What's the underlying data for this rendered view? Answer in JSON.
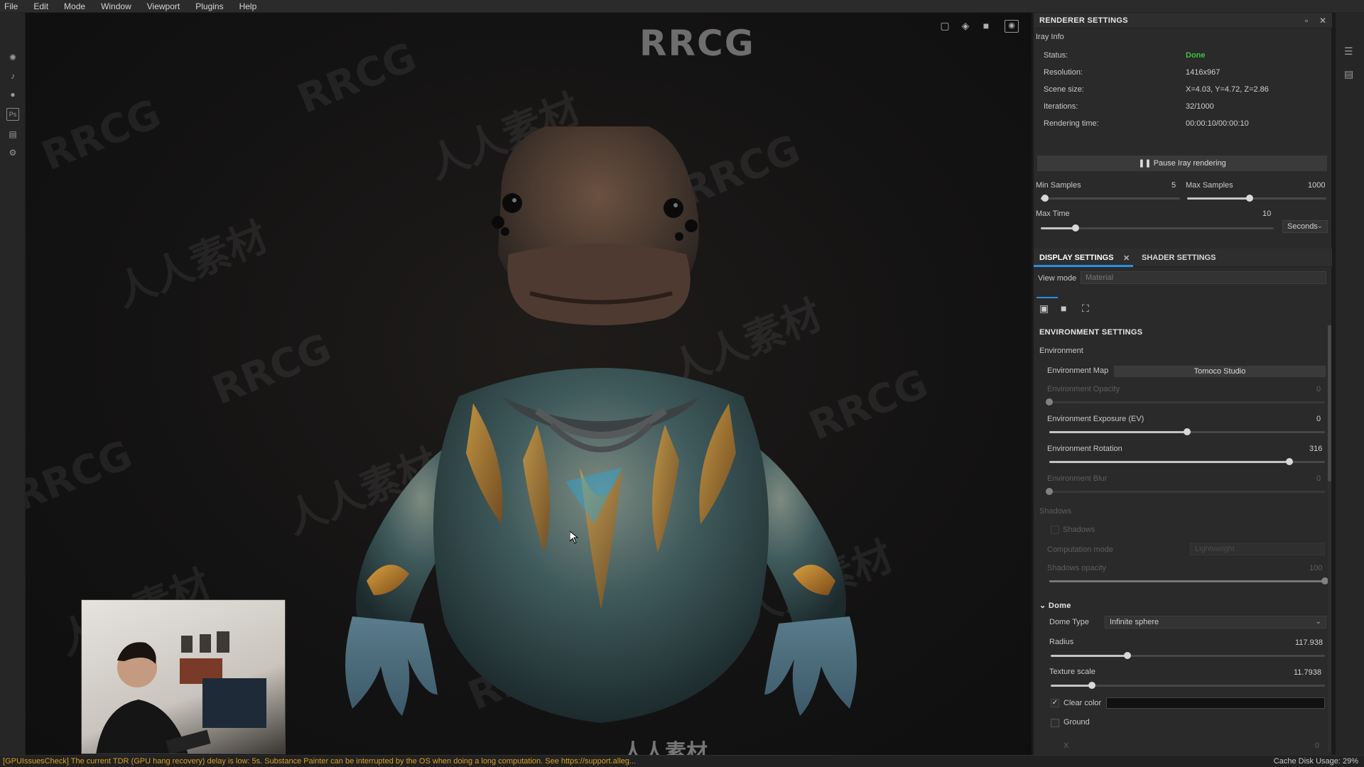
{
  "menu": [
    "File",
    "Edit",
    "Mode",
    "Window",
    "Viewport",
    "Plugins",
    "Help"
  ],
  "viewport": {
    "brand": "RRCG",
    "footer_logo": "人人素材",
    "watermarks": [
      "RRCG",
      "人人素材"
    ]
  },
  "renderer": {
    "title": "RENDERER SETTINGS",
    "subtitle": "Iray Info",
    "info": [
      {
        "label": "Status:",
        "value": "Done"
      },
      {
        "label": "Resolution:",
        "value": "1416x967"
      },
      {
        "label": "Scene size:",
        "value": "X=4.03, Y=4.72, Z=2.86"
      },
      {
        "label": "Iterations:",
        "value": "32/1000"
      },
      {
        "label": "Rendering time:",
        "value": "00:00:10/00:00:10"
      }
    ],
    "pause_button": "Pause Iray rendering",
    "min_samples": {
      "label": "Min Samples",
      "value": "5",
      "level": 0.03
    },
    "max_samples": {
      "label": "Max Samples",
      "value": "1000",
      "level": 0.45
    },
    "max_time": {
      "label": "Max Time",
      "value": "10",
      "level": 0.15,
      "unit": "Seconds"
    }
  },
  "display": {
    "tabs": [
      "DISPLAY SETTINGS",
      "SHADER SETTINGS"
    ],
    "view_mode_label": "View mode",
    "view_mode_value": "Material",
    "env_title": "ENVIRONMENT SETTINGS",
    "env_label": "Environment",
    "env_map_label": "Environment Map",
    "env_map_value": "Tomoco Studio",
    "env_opacity": {
      "label": "Environment Opacity",
      "value": "0",
      "level": 0.0
    },
    "env_exposure": {
      "label": "Environment Exposure (EV)",
      "value": "0",
      "level": 0.5
    },
    "env_rotation": {
      "label": "Environment Rotation",
      "value": "316",
      "level": 0.87
    },
    "env_blur": {
      "label": "Environment Blur",
      "value": "0",
      "level": 0.0
    },
    "shadows_section": "Shadows",
    "shadows_checkbox": "Shadows",
    "computation_label": "Computation mode",
    "computation_value": "Lightweight",
    "shadows_opacity": {
      "label": "Shadows opacity",
      "value": "100",
      "level": 1.0
    },
    "dome_title": "Dome",
    "dome_type_label": "Dome Type",
    "dome_type_value": "Infinite sphere",
    "radius": {
      "label": "Radius",
      "value": "117.938",
      "level": 0.28
    },
    "texture_scale": {
      "label": "Texture scale",
      "value": "11.7938",
      "level": 0.15
    },
    "clear_color_label": "Clear color",
    "ground_label": "Ground",
    "x_label": "X",
    "x_value": "0"
  },
  "status": {
    "message": "[GPUIssuesCheck] The current TDR (GPU hang recovery) delay is low: 5s. Substance Painter can be interrupted by the OS when doing a long computation. See https://support.alleg...",
    "cache": "Cache Disk Usage:  29%"
  },
  "colors": {
    "accent": "#2a8ee0",
    "status_done": "#3ec43e",
    "warning": "#e0a020"
  }
}
